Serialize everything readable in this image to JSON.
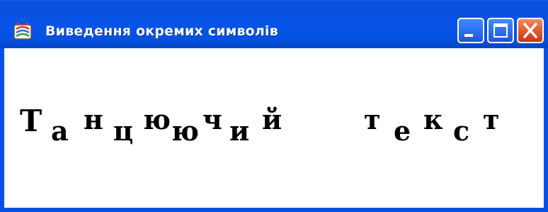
{
  "window": {
    "title": "Виведення окремих символів",
    "titlebar_color": "#0552e2",
    "icons": [
      "app-icon",
      "minimize-icon",
      "maximize-icon",
      "close-icon"
    ]
  },
  "content": {
    "text": "Танцюючий текст",
    "glyphs": [
      {
        "char": "Т",
        "baseline": "high"
      },
      {
        "char": "а",
        "baseline": "low"
      },
      {
        "char": "н",
        "baseline": "high"
      },
      {
        "char": "ц",
        "baseline": "low"
      },
      {
        "char": "ю",
        "baseline": "high"
      },
      {
        "char": "ю",
        "baseline": "low"
      },
      {
        "char": "ч",
        "baseline": "high"
      },
      {
        "char": "и",
        "baseline": "low"
      },
      {
        "char": "й",
        "baseline": "high"
      },
      {
        "char": "т",
        "baseline": "high"
      },
      {
        "char": "е",
        "baseline": "low"
      },
      {
        "char": "к",
        "baseline": "high"
      },
      {
        "char": "с",
        "baseline": "low"
      },
      {
        "char": "т",
        "baseline": "high"
      }
    ]
  }
}
